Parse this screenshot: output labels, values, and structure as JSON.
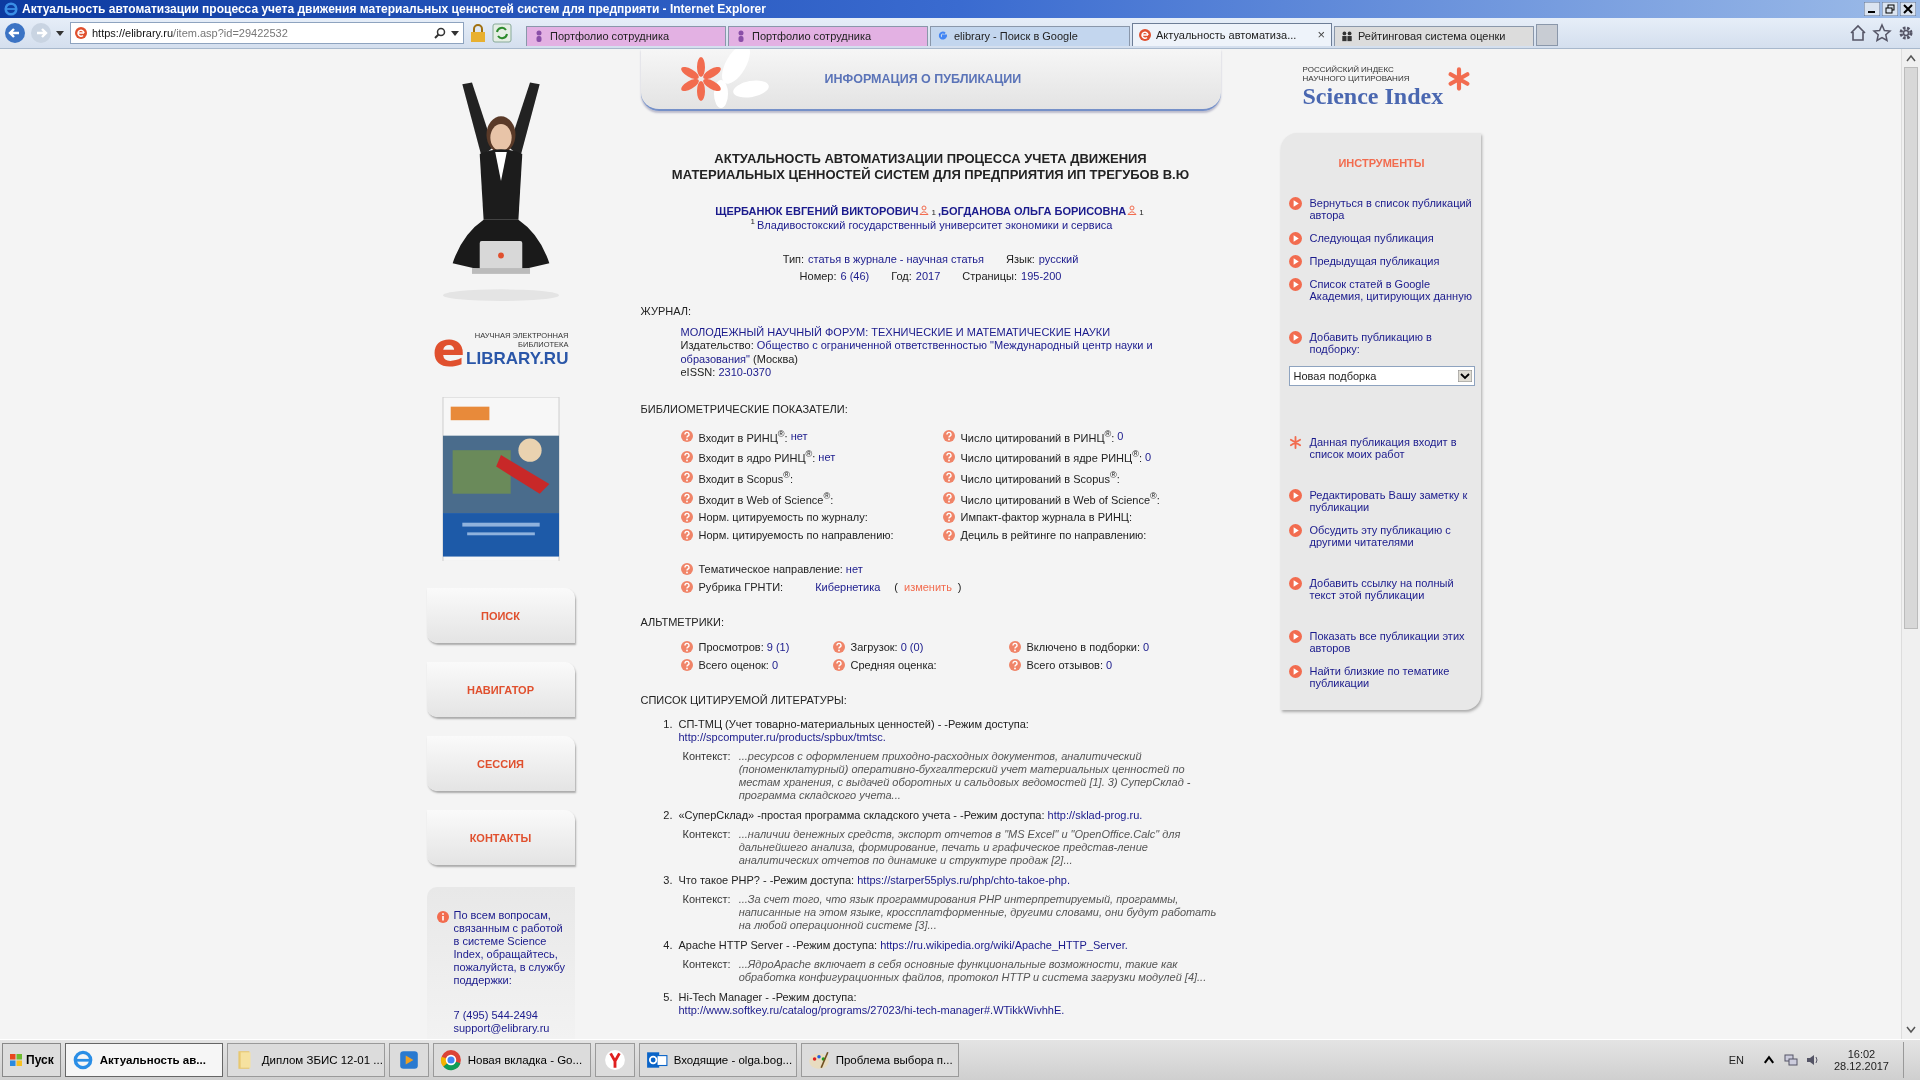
{
  "window": {
    "title": "Актуальность автоматизации процесса учета движения материальных ценностей систем для предприяти - Internet Explorer"
  },
  "browser": {
    "url_host": "https://elibrary.ru",
    "url_path": "/item.asp?id=29422532",
    "tabs": [
      {
        "label": "Портфолио сотрудника",
        "selected": false,
        "color": "#e3b1e3",
        "kind": "person"
      },
      {
        "label": "Портфолио сотрудника",
        "selected": false,
        "color": "#e3b1e3",
        "kind": "person"
      },
      {
        "label": "elibrary - Поиск в Google",
        "selected": false,
        "color": "#c3d6ee",
        "kind": "google"
      },
      {
        "label": "Актуальность автоматиза...",
        "selected": true,
        "color": "#eef3fa",
        "kind": "elibrary",
        "close": "×"
      },
      {
        "label": "Рейтинговая система оценки",
        "selected": false,
        "color": "#dcdcdc",
        "kind": "people"
      }
    ]
  },
  "left": {
    "logo": {
      "caption": "НАУЧНАЯ ЭЛЕКТРОННАЯ БИБЛИОТЕКА",
      "letter": "e",
      "name": "LIBRARY.RU"
    },
    "nav": [
      "ПОИСК",
      "НАВИГАТОР",
      "СЕССИЯ",
      "КОНТАКТЫ"
    ],
    "support": {
      "text": "По всем вопросам, связанным с работой в системе Science Index, обращайтесь, пожалуйста, в службу поддержки:",
      "phone": "7 (495) 544-2494",
      "email": "support@elibrary.ru"
    }
  },
  "center": {
    "header": "ИНФОРМАЦИЯ О ПУБЛИКАЦИИ",
    "title": "АКТУАЛЬНОСТЬ АВТОМАТИЗАЦИИ ПРОЦЕССА УЧЕТА ДВИЖЕНИЯ МАТЕРИАЛЬНЫХ ЦЕННОСТЕЙ СИСТЕМ ДЛЯ ПРЕДПРИЯТИЯ ИП ТРЕГУБОВ В.Ю",
    "authors": [
      {
        "name": "ЩЕРБАНЮК ЕВГЕНИЙ ВИКТОРОВИЧ",
        "sup": "1",
        "sep": ","
      },
      {
        "name": "БОГДАНОВА ОЛЬГА БОРИСОВНА",
        "sup": "1"
      }
    ],
    "affiliation": {
      "sup": "1",
      "text": "Владивостокский государственный университет экономики и сервиса"
    },
    "meta": [
      [
        {
          "label": "Тип:",
          "value": "статья в журнале - научная статья"
        },
        {
          "label": "Язык:",
          "value": "русский"
        }
      ],
      [
        {
          "label": "Номер:",
          "value": "6 (46)"
        },
        {
          "label": "Год:",
          "value": "2017"
        },
        {
          "label": "Страницы:",
          "value": "195-200"
        }
      ]
    ],
    "journal": {
      "heading": "ЖУРНАЛ:",
      "name": "МОЛОДЕЖНЫЙ НАУЧНЫЙ ФОРУМ: ТЕХНИЧЕСКИЕ И МАТЕМАТИЧЕСКИЕ НАУКИ",
      "publisher_label": "Издательство:",
      "publisher": "Общество с ограниченной ответственностью \"Международный центр науки и образования\"",
      "city": "(Москва)",
      "eissn_label": "eISSN:",
      "eissn": "2310-0370"
    },
    "biblio": {
      "heading": "БИБЛИОМЕТРИЧЕСКИЕ ПОКАЗАТЕЛИ:",
      "rows": [
        {
          "label": "Входит в РИНЦ$^{®}$:",
          "value": "нет"
        },
        {
          "label": "Число цитирований в РИНЦ$^{®}$:",
          "value": "0"
        },
        {
          "label": "Входит в ядро РИНЦ$^{®}$:",
          "value": "нет"
        },
        {
          "label": "Число цитирований в ядре РИНЦ$^{®}$:",
          "value": "0"
        },
        {
          "label": "Входит в Scopus$^{®}$:"
        },
        {
          "label": "Число цитирований в Scopus$^{®}$:"
        },
        {
          "label": "Входит в Web of Science$^{®}$:"
        },
        {
          "label": "Число цитирований в Web of Science$^{®}$:"
        },
        {
          "label": "Норм. цитируемость по журналу:"
        },
        {
          "label": "Импакт-фактор журнала в РИНЦ:"
        },
        {
          "label": "Норм. цитируемость по направлению:"
        },
        {
          "label": "Дециль в рейтинге по направлению:"
        }
      ],
      "topic": {
        "label": "Тематическое направление:",
        "value": "нет"
      },
      "rubric": {
        "label": "Рубрика ГРНТИ:",
        "value": "Кибернетика",
        "open": "(",
        "link": "изменить",
        "close": ")"
      }
    },
    "alt": {
      "heading": "АЛЬТМЕТРИКИ:",
      "rows": [
        {
          "label": "Просмотров:",
          "value": "9 (1)"
        },
        {
          "label": "Загрузок:",
          "value": "0 (0)"
        },
        {
          "label": "Включено в подборки:",
          "value": "0"
        },
        {
          "label": "Всего оценок:",
          "value": "0"
        },
        {
          "label": "Средняя оценка:"
        },
        {
          "label": "Всего отзывов:",
          "value": "0"
        }
      ]
    },
    "refs": {
      "heading": "СПИСОК ЦИТИРУЕМОЙ ЛИТЕРАТУРЫ:",
      "items": [
        {
          "num": "1.",
          "text": "СП-ТМЦ (Учет товарно-материальных ценностей) - -Режим доступа:",
          "link": "http://spcomputer.ru/products/spbux/tmtsc.",
          "context_label": "Контекст:",
          "context": "...ресурсов с оформлением приходно-расходных документов, аналитический (пономенклатурный) оперативно-бухгалтерский учет материальных ценностей по местам хранения, с выдачей оборотных и сальдовых ведомостей [1]. 3) СуперСклад - программа складского учета..."
        },
        {
          "num": "2.",
          "text": "«СуперСклад» -простая программа складского учета - -Режим доступа:",
          "link": "http://sklad-prog.ru.",
          "context_label": "Контекст:",
          "context": "...наличии денежных средств, экспорт отчетов в \"MS Excel\" и \"OpenOffice.Calc\" для дальнейшего анализа, формирование, печать и графическое представ-ление аналитических отчетов по динамике и структуре продаж [2]..."
        },
        {
          "num": "3.",
          "text": "Что такое PHP? - -Режим доступа:",
          "link": "https://starper55plys.ru/php/chto-takoe-php.",
          "context_label": "Контекст:",
          "context": "...За счет того, что язык программирования PHP интерпретируемый, программы, написанные на этом языке, кроссплатформенные, другими словами, они будут работать на любой операционной системе [3]..."
        },
        {
          "num": "4.",
          "text": "Apache HTTP Server - -Режим доступа:",
          "link": "https://ru.wikipedia.org/wiki/Apache_HTTP_Server.",
          "context_label": "Контекст:",
          "context": "...ЯдроApache включает в себя основные функциональные возможности, такие как обработка конфигурационных файлов, протокол HTTP и система загрузки модулей [4]..."
        },
        {
          "num": "5.",
          "text": "Hi-Tech Manager - -Режим доступа:",
          "link": "http://www.softkey.ru/catalog/programs/27023/hi-tech-manager#.WTikkWivhhE."
        }
      ]
    }
  },
  "right": {
    "logo": {
      "line1": "РОССИЙСКИЙ ИНДЕКС",
      "line2": "НАУЧНОГО ЦИТИРОВАНИЯ",
      "name": "Science Index"
    },
    "tools": {
      "title": "ИНСТРУМЕНТЫ",
      "groups": [
        [
          {
            "kind": "link",
            "text": "Вернуться в список публикаций автора"
          },
          {
            "kind": "link",
            "text": "Следующая публикация"
          },
          {
            "kind": "link",
            "text": "Предыдущая публикация"
          },
          {
            "kind": "link",
            "text": "Список статей в Google Академия, цитирующих данную"
          }
        ],
        [
          {
            "kind": "link",
            "text": "Добавить публикацию в подборку:"
          },
          {
            "kind": "select",
            "text": "Новая подборка"
          }
        ],
        [
          {
            "kind": "star",
            "text": "Данная публикация входит в список моих работ"
          }
        ],
        [
          {
            "kind": "link",
            "text": "Редактировать Вашу заметку к публикации"
          },
          {
            "kind": "link",
            "text": "Обсудить эту публикацию с другими читателями"
          }
        ],
        [
          {
            "kind": "link",
            "text": "Добавить ссылку на полный текст этой публикации"
          }
        ],
        [
          {
            "kind": "link",
            "text": "Показать все публикации этих авторов"
          },
          {
            "kind": "link",
            "text": "Найти близкие по тематике публикации"
          }
        ]
      ]
    }
  },
  "taskbar": {
    "start": "Пуск",
    "items": [
      {
        "kind": "ie",
        "label": "Актуальность ав...",
        "selected": true
      },
      {
        "kind": "folder",
        "label": "Диплом ЗБИС 12-01 ...",
        "selected": false
      },
      {
        "kind": "media",
        "selected": false
      },
      {
        "kind": "chrome",
        "label": "Новая вкладка - Go...",
        "selected": false
      },
      {
        "kind": "yandex",
        "selected": false
      },
      {
        "kind": "outlook",
        "label": "Входящие - olga.bog...",
        "selected": false
      },
      {
        "kind": "paint",
        "label": "Проблема выбора п...",
        "selected": false
      }
    ],
    "lang": "EN",
    "time": "16:02",
    "date": "28.12.2017"
  }
}
